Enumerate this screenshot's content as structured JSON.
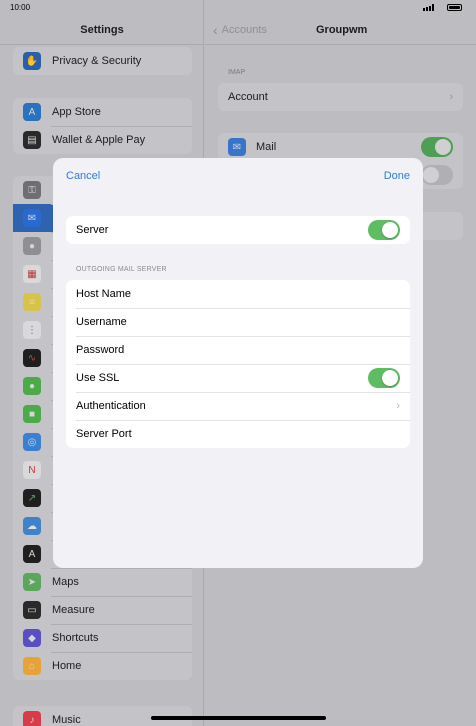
{
  "status_bar": {
    "time": "10:00"
  },
  "sidebar": {
    "title": "Settings",
    "items": [
      {
        "label": "Privacy & Security",
        "icon": "hand-icon",
        "color": "#2c5fa9"
      },
      {
        "label": "App Store",
        "icon": "app-store-icon",
        "color": "#2a71bf"
      },
      {
        "label": "Wallet & Apple Pay",
        "icon": "wallet-icon",
        "color": "#2a2a2a"
      },
      {
        "label": "",
        "icon": "passwords-key-icon",
        "color": "#6f6f73"
      },
      {
        "label": "",
        "icon": "mail-icon",
        "color": "#2a6ad0"
      },
      {
        "label": "",
        "icon": "contacts-icon",
        "color": "#8e8e93"
      },
      {
        "label": "",
        "icon": "calendar-icon",
        "color": "#d9d9dc"
      },
      {
        "label": "",
        "icon": "notes-icon",
        "color": "#d8c24e"
      },
      {
        "label": "",
        "icon": "reminders-icon",
        "color": "#d9d9dc"
      },
      {
        "label": "",
        "icon": "voice-memos-icon",
        "color": "#1f1f1f"
      },
      {
        "label": "",
        "icon": "messages-icon",
        "color": "#4caa48"
      },
      {
        "label": "",
        "icon": "facetime-icon",
        "color": "#4caa48"
      },
      {
        "label": "",
        "icon": "safari-icon",
        "color": "#3a7fd0"
      },
      {
        "label": "",
        "icon": "news-icon",
        "color": "#d9d9dc"
      },
      {
        "label": "",
        "icon": "stocks-icon",
        "color": "#1f1f1f"
      },
      {
        "label": "",
        "icon": "weather-icon",
        "color": "#3f82c8"
      },
      {
        "label": "",
        "icon": "translate-icon",
        "color": "#1f1f1f"
      },
      {
        "label": "Maps",
        "icon": "maps-icon",
        "color": "#5aa65a"
      },
      {
        "label": "Measure",
        "icon": "measure-icon",
        "color": "#2a2a2a"
      },
      {
        "label": "Shortcuts",
        "icon": "shortcuts-icon",
        "color": "#5a4fc0"
      },
      {
        "label": "Home",
        "icon": "home-icon",
        "color": "#e8a23a"
      },
      {
        "label": "Music",
        "icon": "music-icon",
        "color": "#d83b4a"
      }
    ]
  },
  "detail": {
    "back_label": "Accounts",
    "title": "Groupwm",
    "section_imap": "IMAP",
    "account_label": "Account",
    "mail_label": "Mail"
  },
  "modal": {
    "cancel_label": "Cancel",
    "done_label": "Done",
    "server_label": "Server",
    "server_on": true,
    "outgoing_header": "OUTGOING MAIL SERVER",
    "rows": {
      "host_name": "Host Name",
      "username": "Username",
      "password": "Password",
      "use_ssl": "Use SSL",
      "authentication": "Authentication",
      "server_port": "Server Port"
    },
    "use_ssl_on": true
  },
  "colors": {
    "accent": "#2f7bd6",
    "toggle_on": "#5ebd63"
  }
}
